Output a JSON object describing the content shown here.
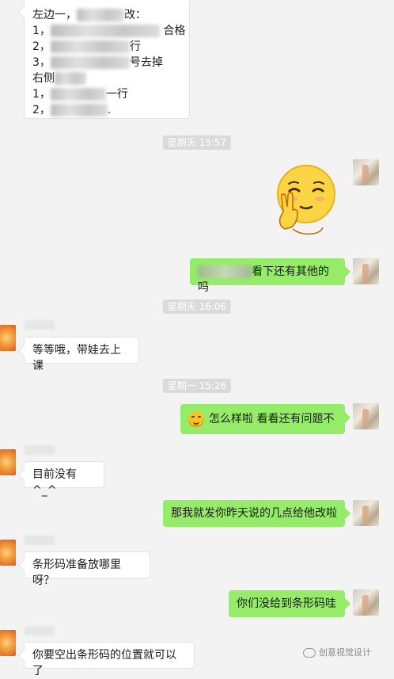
{
  "messages": {
    "m1": {
      "line1_a": "左边一，",
      "line1_b": "改：",
      "line2_a": "1，",
      "line2_b": "合格",
      "line3_a": "2，",
      "line3_b": "行",
      "line4_a": "3，",
      "line4_b": "号去掉",
      "line5": "右侧",
      "line6_a": "1，",
      "line6_b": "一行",
      "line7_a": "2，",
      "line7_b": "."
    },
    "ts1": "星期天 15:57",
    "m2_text": "看下还有其他的吗",
    "ts2": "星期天 16:06",
    "m3_text": "等等哦，带娃去上课",
    "ts3": "星期一 15:26",
    "m4_text": "怎么样啦 看看还有问题不",
    "m5_text": "目前没有^_^",
    "m6_text": "那我就发你昨天说的几点给他改啦",
    "m7_text": "条形码准备放哪里呀？",
    "m8_text": "你们没给到条形码哇",
    "m9_text": "你要空出条形码的位置就可以了"
  },
  "watermark": "创意视觉设计",
  "icons": {
    "relieved_sticker": "relieved-face-sticker",
    "inline_emoji": "smiling-emoji-icon",
    "watermark_icon": "wechat-icon"
  },
  "colors": {
    "background": "#f3f3f3",
    "sent_bubble": "#95ec69",
    "received_bubble": "#ffffff",
    "timestamp_bg": "#dadada"
  }
}
